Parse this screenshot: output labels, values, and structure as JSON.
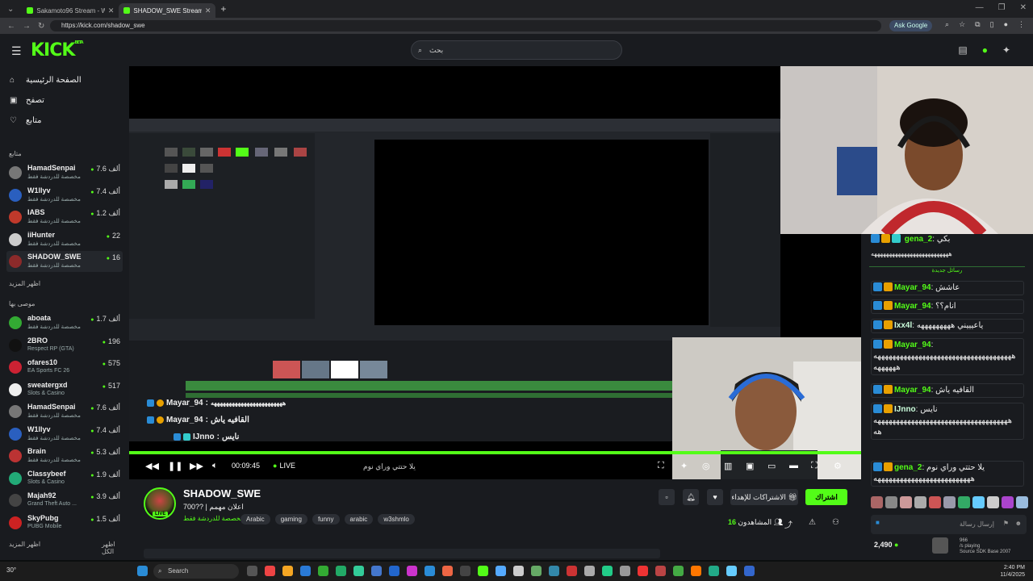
{
  "browser": {
    "tabs": [
      {
        "title": "Sakamoto96 Stream - Watch Li...",
        "active": false
      },
      {
        "title": "SHADOW_SWE Stream - W...",
        "active": true
      }
    ],
    "url": "https://kick.com/shadow_swe",
    "ask_google": "Ask Google"
  },
  "header": {
    "logo": "KICK",
    "logo_beta": "BETA",
    "search_placeholder": "بحث"
  },
  "sidebar": {
    "nav": [
      {
        "label": "الصفحة الرئيسية",
        "icon": "home-icon"
      },
      {
        "label": "تصفح",
        "icon": "browse-icon"
      },
      {
        "label": "متابع",
        "icon": "heart-icon"
      }
    ],
    "following_title": "متابع",
    "following": [
      {
        "name": "HamadSenpai",
        "sub": "مخصصة للدردشة فقط",
        "viewers": "7.6 ألف",
        "color": "#777"
      },
      {
        "name": "W1llyv",
        "sub": "مخصصة للدردشة فقط",
        "viewers": "7.4 ألف",
        "color": "#2a5fbf"
      },
      {
        "name": "IABS",
        "sub": "مخصصة للدردشة فقط",
        "viewers": "1.2 ألف",
        "color": "#c0392b"
      },
      {
        "name": "iiHunter",
        "sub": "مخصصة للدردشة فقط",
        "viewers": "22",
        "color": "#ccc"
      },
      {
        "name": "SHADOW_SWE",
        "sub": "مخصصة للدردشة فقط",
        "viewers": "16",
        "color": "#8b2a2a"
      }
    ],
    "show_more": "اظهر المزيد",
    "recommended_title": "موصى بها",
    "recommended": [
      {
        "name": "aboata",
        "sub": "مخصصة للدردشة فقط",
        "viewers": "1.7 ألف",
        "color": "#3a3"
      },
      {
        "name": "2BRO",
        "sub": "Respect RP (GTA)",
        "viewers": "196",
        "color": "#111"
      },
      {
        "name": "ofares10",
        "sub": "EA Sports FC 26",
        "viewers": "575",
        "color": "#c23"
      },
      {
        "name": "sweatergxd",
        "sub": "Slots & Casino",
        "viewers": "517",
        "color": "#eee"
      },
      {
        "name": "HamadSenpai",
        "sub": "مخصصة للدردشة فقط",
        "viewers": "7.6 ألف",
        "color": "#777"
      },
      {
        "name": "W1llyv",
        "sub": "مخصصة للدردشة فقط",
        "viewers": "7.4 ألف",
        "color": "#2a5fbf"
      },
      {
        "name": "Brain",
        "sub": "مخصصة للدردشة فقط",
        "viewers": "5.3 ألف",
        "color": "#b33"
      },
      {
        "name": "Classybeef",
        "sub": "Slots & Casino",
        "viewers": "1.9 ألف",
        "color": "#2a7"
      },
      {
        "name": "Majah92",
        "sub": "Grand Theft Auto ...",
        "viewers": "3.9 ألف",
        "color": "#444"
      },
      {
        "name": "SkyPubg",
        "sub": "PUBG Mobile",
        "viewers": "1.5 ألف",
        "color": "#c22"
      }
    ],
    "show_more_2": "اظهر المزيد",
    "show_all": "اظهر الكل"
  },
  "player": {
    "overlay_msgs": [
      {
        "user": "Mayar_94",
        "text": "ههههههههههههههههههههههههه"
      },
      {
        "user": "Mayar_94",
        "text": "القافيه ياش"
      },
      {
        "user": "IJnno",
        "text": "نايس"
      }
    ],
    "elapsed": "00:09:45",
    "live_label": "LIVE",
    "caption": "يلا حتتي وراي نوم",
    "progress": 1.0
  },
  "stream": {
    "name": "SHADOW_SWE",
    "title": "700?? | اعلان مهمم",
    "category": "مخصصة للدردشة فقط",
    "tags": [
      "Arabic",
      "gaming",
      "funny",
      "arabic",
      "w3shmlo"
    ],
    "live_badge": "LIVE",
    "subscribe": "اشتراك",
    "gift_subs": "الاشتراكات للإهداء",
    "viewers_label": "المشاهدون",
    "viewers": "16"
  },
  "chat": {
    "top_msgs": [
      {
        "user": "gena_2",
        "text": "بكي",
        "color": "#53fc18"
      },
      {
        "user": "",
        "text": "ههههههههههههههههههههههههههه",
        "color": "#eee"
      }
    ],
    "new_messages_label": "رسائل جديدة",
    "messages": [
      {
        "user": "Mayar_94",
        "text": "عاشش",
        "color": "#53fc18"
      },
      {
        "user": "Mayar_94",
        "text": "انام؟؟",
        "color": "#53fc18"
      },
      {
        "user": "Ixx4l",
        "text": "ياعيييني هههههههههه",
        "color": "#cfd"
      },
      {
        "user": "Mayar_94",
        "text": "هههههههههههههههههههههههههههههههههههههه ههههههه",
        "color": "#53fc18"
      },
      {
        "user": "Mayar_94",
        "text": "القافيه ياش",
        "color": "#53fc18"
      },
      {
        "user": "IJnno",
        "text": "نايس ههههههههههههههههههههههههههههههههههههه هه",
        "color": "#cfd"
      },
      {
        "user": "gena_2",
        "text": "يلا حتتي وراي نوم ههههههههههههههههههههههههههه",
        "color": "#53fc18"
      }
    ],
    "input_placeholder": "إرسال رسالة",
    "points": "2,490",
    "mini_game": "966",
    "mini_sub": "/s playing",
    "mini_src": "Source SDK Base 2007"
  },
  "taskbar": {
    "weather": "30°",
    "search": "Search",
    "time": "2:40 PM",
    "date": "11/4/2025"
  }
}
